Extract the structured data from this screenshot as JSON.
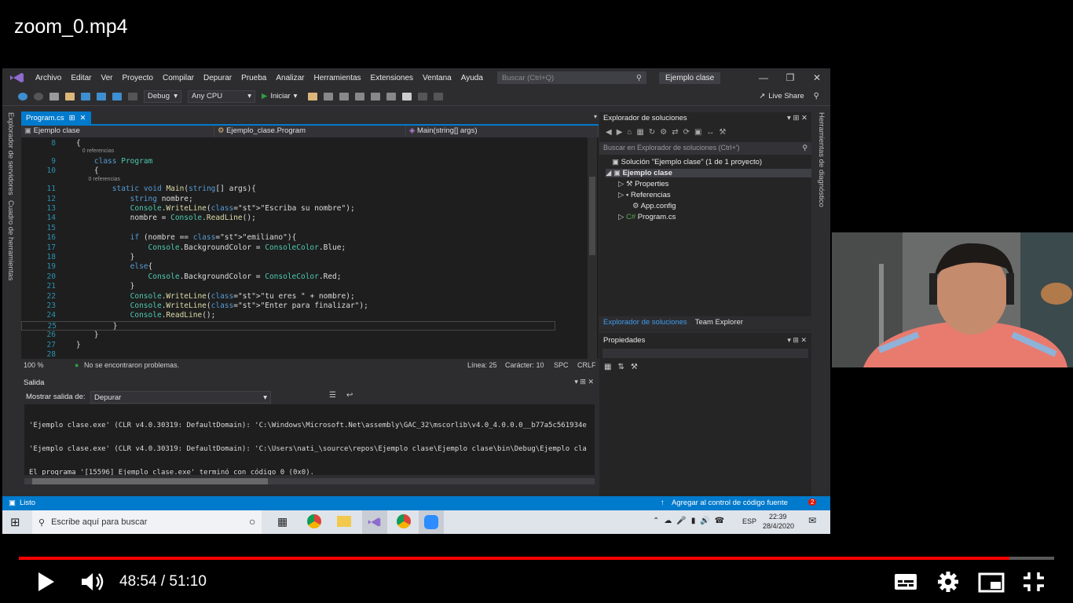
{
  "video": {
    "title": "zoom_0.mp4",
    "time_current": "48:54",
    "time_separator": " / ",
    "time_total": "51:10",
    "progress_fraction": 0.957
  },
  "menu": [
    "Archivo",
    "Editar",
    "Ver",
    "Proyecto",
    "Compilar",
    "Depurar",
    "Prueba",
    "Analizar",
    "Herramientas",
    "Extensiones",
    "Ventana",
    "Ayuda"
  ],
  "search_placeholder": "Buscar (Ctrl+Q)",
  "project_badge": "Ejemplo clase",
  "toolbar": {
    "config": "Debug",
    "platform": "Any CPU",
    "run_label": "Iniciar",
    "live_share": "Live Share"
  },
  "side_left": [
    "Explorador de servidores",
    "Cuadro de herramientas"
  ],
  "side_right": "Herramientas de diagnóstico",
  "editor": {
    "tab": "Program.cs",
    "nav_project": "Ejemplo clase",
    "nav_class": "Ejemplo_clase.Program",
    "nav_member": "Main(string[] args)",
    "code": [
      {
        "n": "8",
        "t": "{"
      },
      {
        "n": "",
        "t": "    0 referencias",
        "ref": true
      },
      {
        "n": "9",
        "t": "    class Program"
      },
      {
        "n": "10",
        "t": "    {"
      },
      {
        "n": "",
        "t": "        0 referencias",
        "ref": true
      },
      {
        "n": "11",
        "t": "        static void Main(string[] args){"
      },
      {
        "n": "12",
        "t": "            string nombre;"
      },
      {
        "n": "13",
        "t": "            Console.WriteLine(\"Escriba su nombre\");"
      },
      {
        "n": "14",
        "t": "            nombre = Console.ReadLine();"
      },
      {
        "n": "15",
        "t": ""
      },
      {
        "n": "16",
        "t": "            if (nombre == \"emiliano\"){"
      },
      {
        "n": "17",
        "t": "                Console.BackgroundColor = ConsoleColor.Blue;"
      },
      {
        "n": "18",
        "t": "            }"
      },
      {
        "n": "19",
        "t": "            else{"
      },
      {
        "n": "20",
        "t": "                Console.BackgroundColor = ConsoleColor.Red;"
      },
      {
        "n": "21",
        "t": "            }"
      },
      {
        "n": "22",
        "t": "            Console.WriteLine(\"tu eres \" + nombre);"
      },
      {
        "n": "23",
        "t": "            Console.WriteLine(\"Enter para finalizar\");"
      },
      {
        "n": "24",
        "t": "            Console.ReadLine();"
      },
      {
        "n": "25",
        "t": "        }"
      },
      {
        "n": "26",
        "t": "    }"
      },
      {
        "n": "27",
        "t": "}"
      },
      {
        "n": "28",
        "t": ""
      }
    ],
    "zoom": "100 %",
    "problems": "No se encontraron problemas.",
    "line": "Línea: 25",
    "col": "Carácter: 10",
    "spc": "SPC",
    "crlf": "CRLF"
  },
  "output": {
    "title": "Salida",
    "show_label": "Mostrar salida de:",
    "source": "Depurar",
    "lines": [
      "'Ejemplo clase.exe' (CLR v4.0.30319: DefaultDomain): 'C:\\Windows\\Microsoft.Net\\assembly\\GAC_32\\mscorlib\\v4.0_4.0.0.0__b77a5c561934e",
      "'Ejemplo clase.exe' (CLR v4.0.30319: DefaultDomain): 'C:\\Users\\nati_\\source\\repos\\Ejemplo clase\\Ejemplo clase\\bin\\Debug\\Ejemplo cla",
      "El programa '[15596] Ejemplo clase.exe' terminó con código 0 (0x0)."
    ]
  },
  "solution": {
    "title": "Explorador de soluciones",
    "search": "Buscar en Explorador de soluciones (Ctrl+')",
    "items": [
      "Solución \"Ejemplo clase\" (1 de 1 proyecto)",
      "Ejemplo clase",
      "Properties",
      "Referencias",
      "App.config",
      "Program.cs"
    ],
    "tab_active": "Explorador de soluciones",
    "tab_other": "Team Explorer"
  },
  "properties": {
    "title": "Propiedades"
  },
  "status": {
    "left": "Listo",
    "right": "Agregar al control de código fuente",
    "badge": "2"
  },
  "taskbar": {
    "search": "Escribe aquí para buscar",
    "lang": "ESP",
    "time": "22:39",
    "date": "28/4/2020"
  },
  "colors": {
    "accent": "#007acc",
    "progress": "#ff0000"
  }
}
